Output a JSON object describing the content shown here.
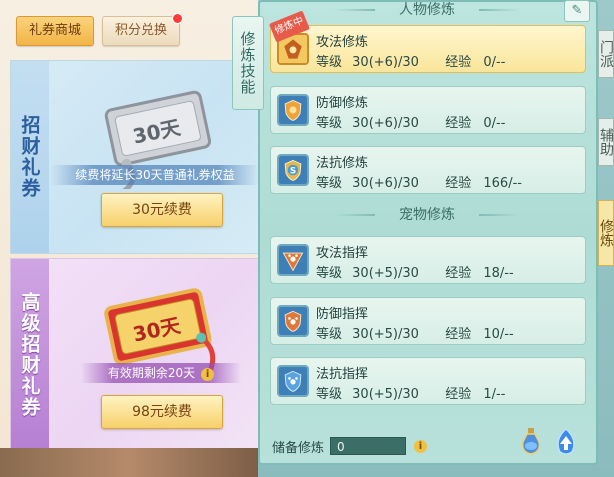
{
  "top_tabs": [
    {
      "label": "礼券商城",
      "active": true
    },
    {
      "label": "积分兑换",
      "active": false,
      "has_red_dot": true
    }
  ],
  "cards": [
    {
      "side_title": "招财礼券",
      "ticket_label": "30天",
      "note": "续费将延长30天普通礼券权益",
      "button": "30元续费"
    },
    {
      "side_title": "高级招财礼券",
      "ticket_label": "30天",
      "note": "有效期剩余20天",
      "button": "98元续费"
    }
  ],
  "panel": {
    "vertical_tab": "修炼技能",
    "sections": [
      {
        "header": "人物修炼",
        "skills": [
          {
            "name": "攻法修炼",
            "level_label": "等级",
            "level": "30(+6)/30",
            "exp_label": "经验",
            "exp": "0/--",
            "selected": true,
            "badge": "修炼中",
            "icon": "attack-magic-icon"
          },
          {
            "name": "防御修炼",
            "level_label": "等级",
            "level": "30(+6)/30",
            "exp_label": "经验",
            "exp": "0/--",
            "icon": "defense-icon"
          },
          {
            "name": "法抗修炼",
            "level_label": "等级",
            "level": "30(+6)/30",
            "exp_label": "经验",
            "exp": "166/--",
            "icon": "magic-resist-icon"
          }
        ]
      },
      {
        "header": "宠物修炼",
        "skills": [
          {
            "name": "攻法指挥",
            "level_label": "等级",
            "level": "30(+5)/30",
            "exp_label": "经验",
            "exp": "18/--",
            "icon": "pet-attack-icon"
          },
          {
            "name": "防御指挥",
            "level_label": "等级",
            "level": "30(+5)/30",
            "exp_label": "经验",
            "exp": "10/--",
            "icon": "pet-defense-icon"
          },
          {
            "name": "法抗指挥",
            "level_label": "等级",
            "level": "30(+5)/30",
            "exp_label": "经验",
            "exp": "1/--",
            "icon": "pet-resist-icon"
          }
        ]
      }
    ],
    "reserve_label": "储备修炼",
    "reserve_value": "0"
  },
  "edge_tabs": [
    {
      "label": "门派",
      "active": false
    },
    {
      "label": "辅助",
      "active": false
    },
    {
      "label": "修炼",
      "active": true
    }
  ],
  "colors": {
    "accent_gold": "#f2b447",
    "panel_teal": "#aedcd4",
    "selected_row": "#f9e59a"
  }
}
